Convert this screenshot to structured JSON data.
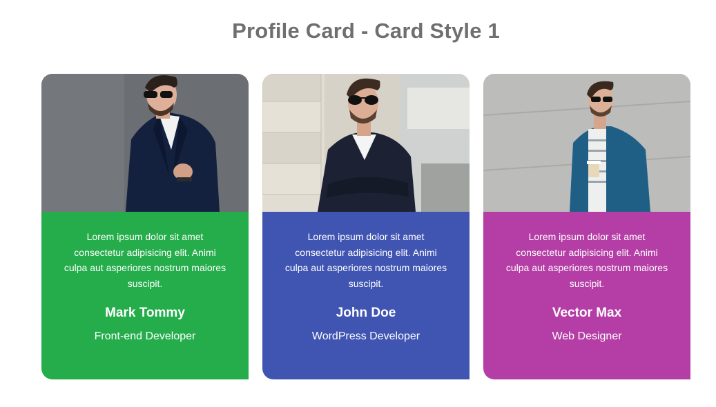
{
  "page": {
    "title": "Profile Card - Card Style 1"
  },
  "cards": [
    {
      "description": "Lorem ipsum dolor sit amet consectetur adipisicing elit. Animi culpa aut asperiores nostrum maiores suscipit.",
      "name": "Mark Tommy",
      "role": "Front-end Developer",
      "color": "#24ad4a",
      "photo_background": "#6b6e72",
      "jacket_color": "#13213f"
    },
    {
      "description": "Lorem ipsum dolor sit amet consectetur adipisicing elit. Animi culpa aut asperiores nostrum maiores suscipit.",
      "name": "John Doe",
      "role": "WordPress Developer",
      "color": "#4055b2",
      "photo_background": "#d6d2c8",
      "jacket_color": "#1c2233"
    },
    {
      "description": "Lorem ipsum dolor sit amet consectetur adipisicing elit. Animi culpa aut asperiores nostrum maiores suscipit.",
      "name": "Vector Max",
      "role": "Web Designer",
      "color": "#b43ea5",
      "photo_background": "#b7b8b6",
      "jacket_color": "#1f5f86"
    }
  ]
}
